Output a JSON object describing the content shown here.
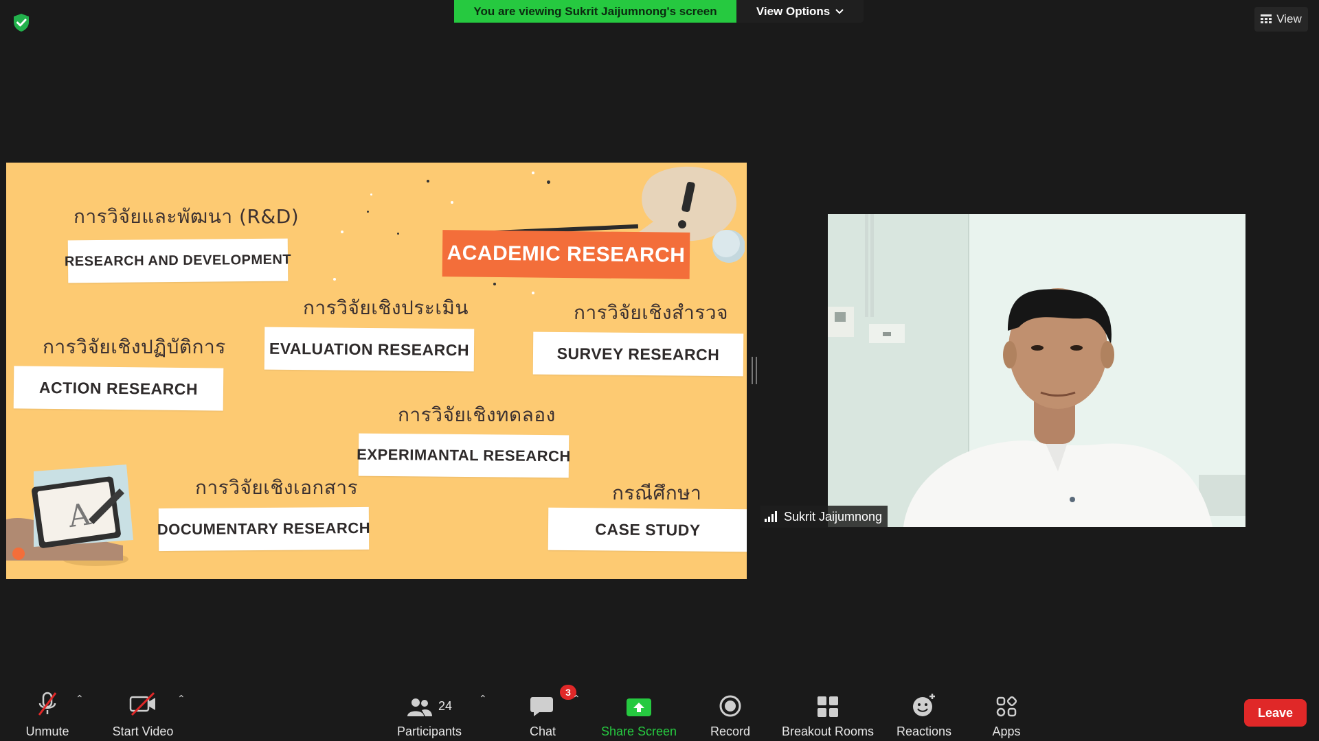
{
  "top": {
    "banner_text": "You are viewing Sukrit Jaijumnong's screen",
    "view_options_label": "View Options",
    "view_label": "View"
  },
  "slide": {
    "academic_label": "ACADEMIC RESEARCH",
    "items": [
      {
        "thai": "การวิจัยและพัฒนา (R&D)",
        "english": "RESEARCH AND DEVELOPMENT"
      },
      {
        "thai": "การวิจัยเชิงประเมิน",
        "english": "EVALUATION RESEARCH"
      },
      {
        "thai": "การวิจัยเชิงสำรวจ",
        "english": "SURVEY RESEARCH"
      },
      {
        "thai": "การวิจัยเชิงปฏิบัติการ",
        "english": "ACTION RESEARCH"
      },
      {
        "thai": "การวิจัยเชิงทดลอง",
        "english": "EXPERIMANTAL RESEARCH"
      },
      {
        "thai": "การวิจัยเชิงเอกสาร",
        "english": "DOCUMENTARY RESEARCH"
      },
      {
        "thai": "กรณีศึกษา",
        "english": "CASE STUDY"
      }
    ]
  },
  "participant": {
    "name": "Sukrit Jaijumnong"
  },
  "toolbar": {
    "unmute": "Unmute",
    "start_video": "Start Video",
    "participants": "Participants",
    "participants_count": "24",
    "chat": "Chat",
    "chat_badge": "3",
    "share_screen": "Share Screen",
    "record": "Record",
    "breakout_rooms": "Breakout Rooms",
    "reactions": "Reactions",
    "apps": "Apps",
    "leave": "Leave"
  },
  "colors": {
    "slide_bg": "#fdca72",
    "academic_bg": "#f36e3a",
    "banner_green": "#26c940",
    "share_green": "#26c940",
    "leave_red": "#e02828"
  }
}
